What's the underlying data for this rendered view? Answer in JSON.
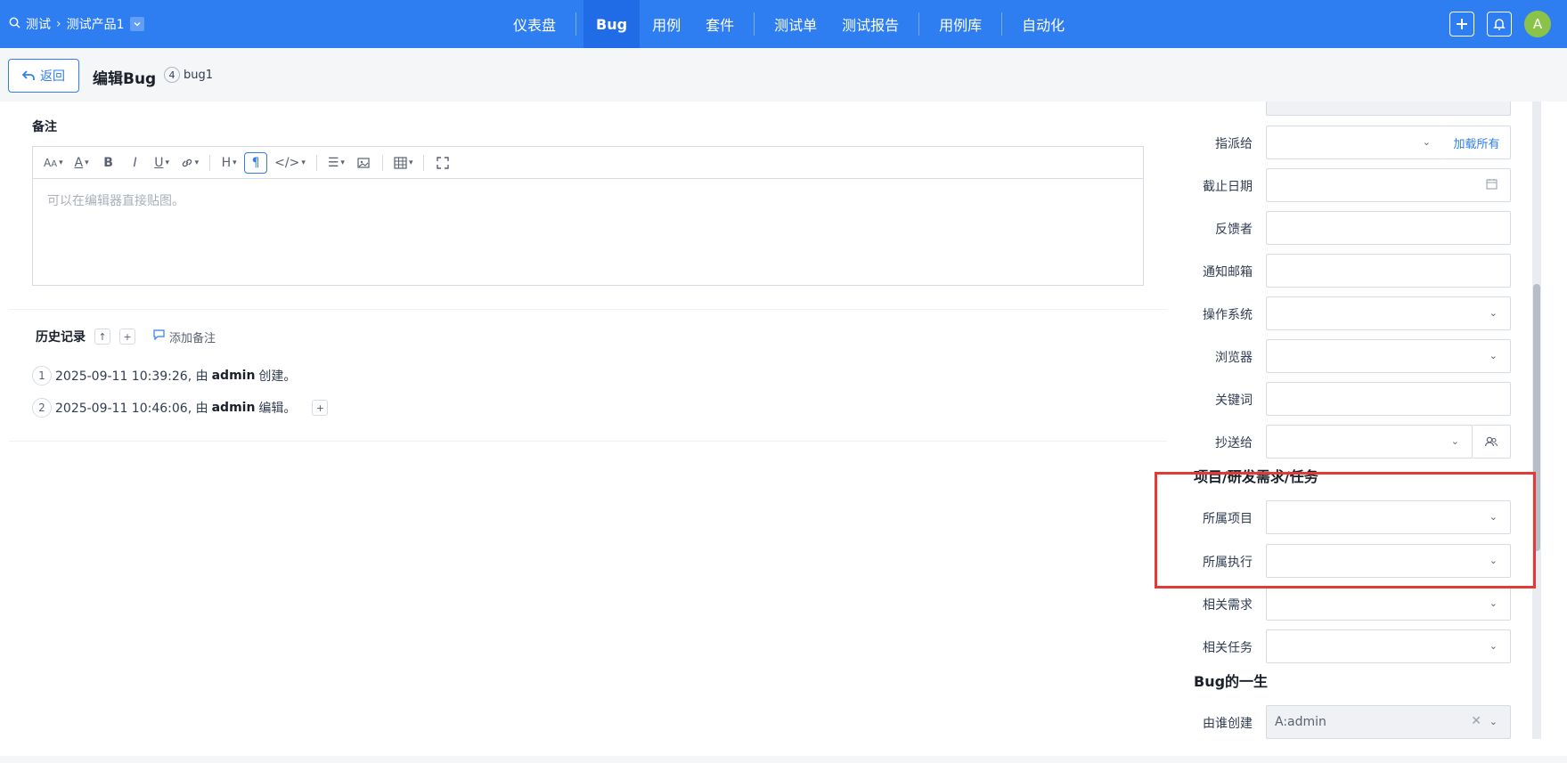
{
  "topnav": {
    "breadcrumb": [
      "测试",
      "测试产品1"
    ],
    "tabs": [
      "仪表盘",
      "Bug",
      "用例",
      "套件",
      "测试单",
      "测试报告",
      "用例库",
      "自动化"
    ],
    "active_tab": "Bug",
    "avatar_letter": "A"
  },
  "header": {
    "back_label": "返回",
    "title": "编辑Bug",
    "bug_id": "4",
    "bug_name": "bug1"
  },
  "notes": {
    "label": "备注",
    "placeholder": "可以在编辑器直接贴图。"
  },
  "history": {
    "title": "历史记录",
    "add_note": "添加备注",
    "entries": [
      {
        "index": "1",
        "time": "2025-09-11 10:39:26, 由 ",
        "user": "admin",
        "action": " 创建。"
      },
      {
        "index": "2",
        "time": "2025-09-11 10:46:06, 由 ",
        "user": "admin",
        "action": " 编辑。"
      }
    ]
  },
  "form": {
    "assigned_to": "指派给",
    "load_all": "加载所有",
    "deadline": "截止日期",
    "feedback_by": "反馈者",
    "notify_email": "通知邮箱",
    "os": "操作系统",
    "browser": "浏览器",
    "keywords": "关键词",
    "cc_to": "抄送给",
    "section_project": "项目/研发需求/任务",
    "project": "所属项目",
    "execution": "所属执行",
    "story": "相关需求",
    "task": "相关任务",
    "section_life": "Bug的一生",
    "created_by": "由谁创建",
    "created_by_value": "A:admin"
  },
  "colors": {
    "brand": "#2e7ef2",
    "highlight": "#e53935"
  }
}
